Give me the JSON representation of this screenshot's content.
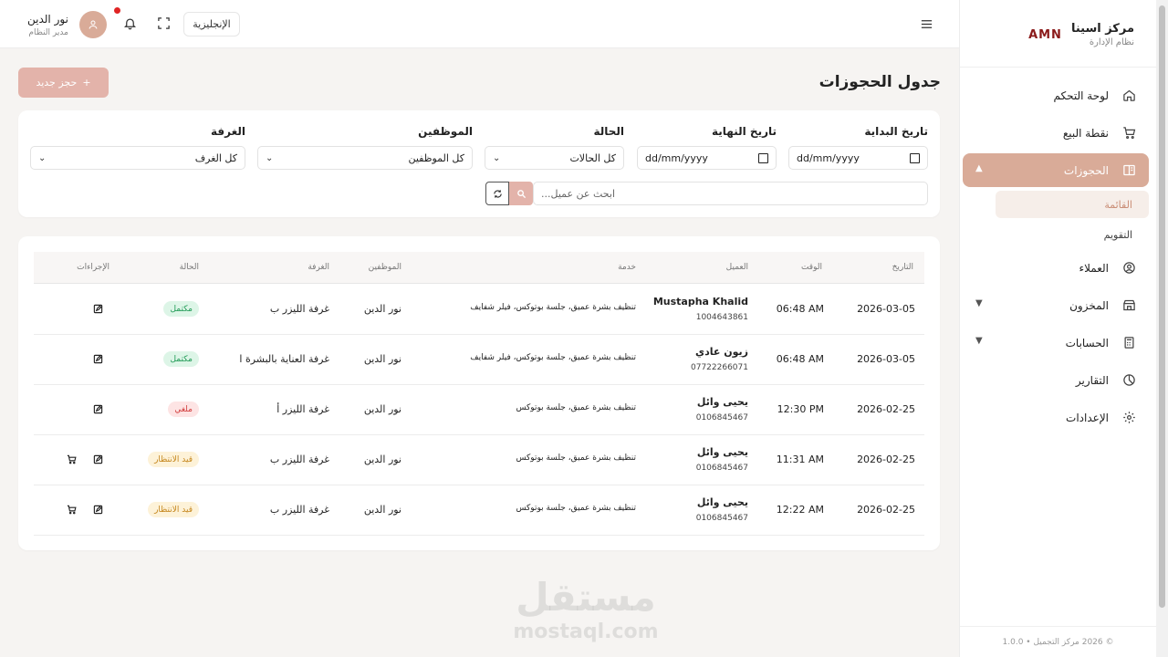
{
  "brand": {
    "title": "مركز اسينا",
    "subtitle": "نظام الإدارة",
    "logo": "AMN"
  },
  "sidebar": {
    "items": [
      {
        "label": "لوحة التحكم",
        "icon": "home-icon"
      },
      {
        "label": "نقطة البيع",
        "icon": "cart-icon"
      },
      {
        "label": "الحجوزات",
        "icon": "book-icon",
        "active": true
      },
      {
        "label": "العملاء",
        "icon": "user-circle-icon"
      },
      {
        "label": "المخزون",
        "icon": "store-icon"
      },
      {
        "label": "الحسابات",
        "icon": "calculator-icon"
      },
      {
        "label": "التقارير",
        "icon": "pie-chart-icon"
      },
      {
        "label": "الإعدادات",
        "icon": "gear-icon"
      }
    ],
    "subitems": [
      {
        "label": "القائمة",
        "active": true
      },
      {
        "label": "التقويم"
      }
    ],
    "footer": "© 2026 مركز التجميل • 1.0.0"
  },
  "topbar": {
    "user_name": "نور الدين",
    "user_role": "مدير النظام",
    "language": "الإنجليزية"
  },
  "page": {
    "title": "جدول الحجوزات",
    "new_button": "حجز جديد"
  },
  "filters": {
    "start_label": "تاريخ البداية",
    "end_label": "تاريخ النهاية",
    "status_label": "الحالة",
    "staff_label": "الموظفين",
    "room_label": "الغرفة",
    "date_placeholder": "dd/mm/yyyy",
    "status_value": "كل الحالات",
    "staff_value": "كل الموظفين",
    "room_value": "كل الغرف",
    "search_placeholder": "ابحث عن عميل..."
  },
  "table": {
    "headers": [
      "التاريخ",
      "الوقت",
      "العميل",
      "خدمة",
      "الموظفين",
      "الغرفة",
      "الحالة",
      "الإجراءات"
    ],
    "rows": [
      {
        "date": "2026-03-05",
        "time": "06:48 AM",
        "client": "Mustapha Khalid",
        "phone": "1004643861",
        "service": "تنظيف بشرة عميق، جلسة بوتوكس، فيلر شفايف",
        "staff": "نور الدين",
        "room": "غرفة الليزر ب",
        "status": "مكتمل",
        "status_color": "green",
        "cart": false
      },
      {
        "date": "2026-03-05",
        "time": "06:48 AM",
        "client": "زيون عادي",
        "phone": "07722266071",
        "service": "تنظيف بشرة عميق، جلسة بوتوكس، فيلر شفايف",
        "staff": "نور الدين",
        "room": "غرفة العناية بالبشرة ا",
        "status": "مكتمل",
        "status_color": "green",
        "cart": false
      },
      {
        "date": "2026-02-25",
        "time": "12:30 PM",
        "client": "يحيى وائل",
        "phone": "0106845467",
        "service": "تنظيف بشرة عميق، جلسة بوتوكس",
        "staff": "نور الدين",
        "room": "غرفة الليزر أ",
        "status": "ملغي",
        "status_color": "red",
        "cart": false
      },
      {
        "date": "2026-02-25",
        "time": "11:31 AM",
        "client": "يحيى وائل",
        "phone": "0106845467",
        "service": "تنظيف بشرة عميق، جلسة بوتوكس",
        "staff": "نور الدين",
        "room": "غرفة الليزر ب",
        "status": "قيد الانتظار",
        "status_color": "yellow",
        "cart": true
      },
      {
        "date": "2026-02-25",
        "time": "12:22 AM",
        "client": "يحيى وائل",
        "phone": "0106845467",
        "service": "تنظيف بشرة عميق، جلسة بوتوكس",
        "staff": "نور الدين",
        "room": "غرفة الليزر ب",
        "status": "قيد الانتظار",
        "status_color": "yellow",
        "cart": true
      }
    ]
  },
  "watermark": {
    "ar": "مستقل",
    "en": "mostaql.com"
  },
  "colors": {
    "accent": "#d9ab98",
    "button": "#e3b3aa"
  }
}
